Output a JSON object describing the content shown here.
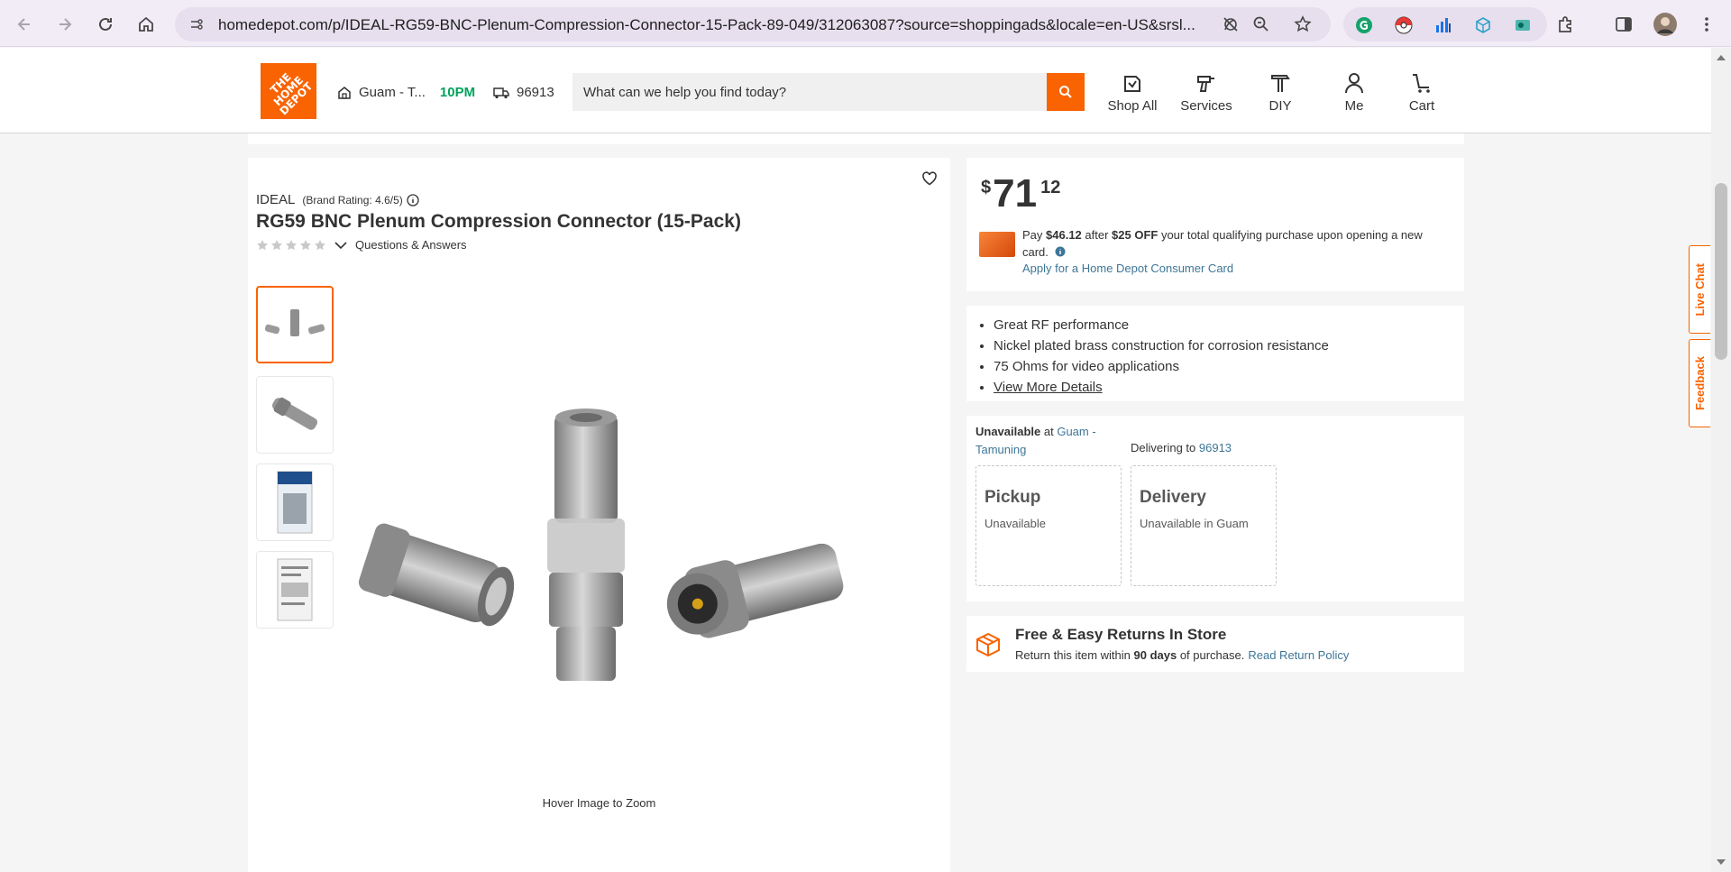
{
  "browser": {
    "url": "homedepot.com/p/IDEAL-RG59-BNC-Plenum-Compression-Connector-15-Pack-89-049/312063087?source=shoppingads&locale=en-US&srsl..."
  },
  "header": {
    "logo_text": "THE HOME DEPOT",
    "store_name": "Guam - T...",
    "store_hours": "10PM",
    "zip": "96913",
    "search_placeholder": "What can we help you find today?",
    "nav": {
      "shop_all": "Shop All",
      "services": "Services",
      "diy": "DIY",
      "me": "Me",
      "cart": "Cart"
    }
  },
  "product": {
    "brand": "IDEAL",
    "brand_rating": "(Brand Rating: 4.6/5)",
    "title": "RG59 BNC Plenum Compression Connector (15-Pack)",
    "rating": 0,
    "qa_label": "Questions & Answers",
    "hover_zoom": "Hover Image to Zoom"
  },
  "price": {
    "currency": "$",
    "dollars": "71",
    "cents": "12",
    "promo_pay": "Pay ",
    "promo_amount": "$46.12",
    "promo_after": " after ",
    "promo_off": "$25 OFF",
    "promo_rest": " your total qualifying purchase upon opening a new card.",
    "promo_link": "Apply for a Home Depot Consumer Card"
  },
  "features": {
    "items": [
      "Great RF performance",
      "Nickel plated brass construction for corrosion resistance",
      "75 Ohms for video applications"
    ],
    "more_link": "View More Details"
  },
  "availability": {
    "unavailable": "Unavailable",
    "at": " at ",
    "store_link": "Guam - Tamuning",
    "delivering_to": "Delivering to ",
    "zip_link": "96913",
    "pickup_title": "Pickup",
    "pickup_status": "Unavailable",
    "delivery_title": "Delivery",
    "delivery_status": "Unavailable in Guam"
  },
  "returns": {
    "title": "Free & Easy Returns In Store",
    "text_before": "Return this item within ",
    "days": "90 days",
    "text_after": " of purchase.",
    "link": "Read Return Policy"
  },
  "side_tabs": {
    "live_chat": "Live Chat",
    "feedback": "Feedback"
  },
  "colors": {
    "brand_orange": "#f96302",
    "link_blue": "#3e7697",
    "hours_green": "#00a35c"
  }
}
